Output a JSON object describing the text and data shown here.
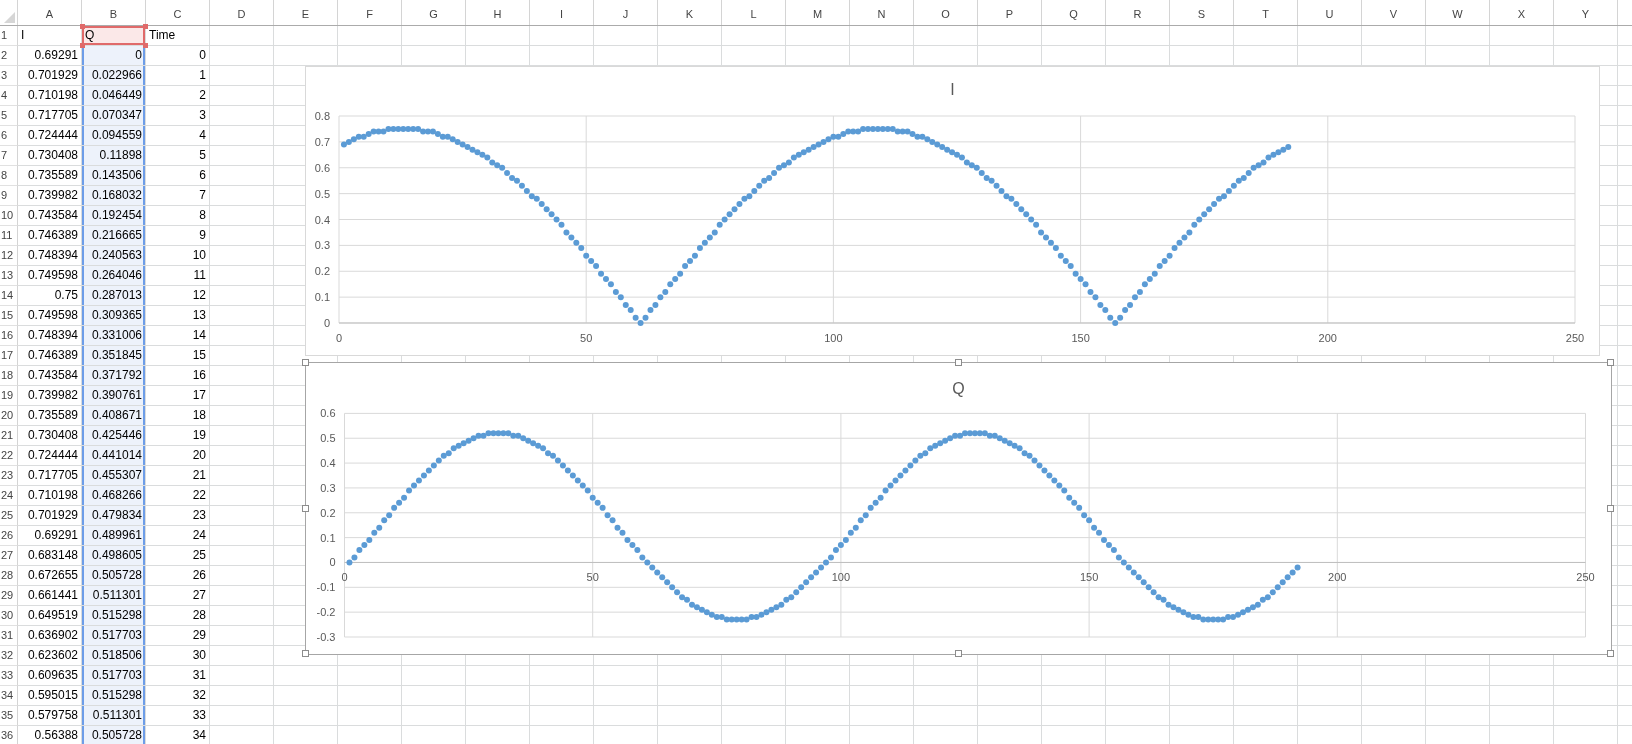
{
  "sheet": {
    "columns": [
      {
        "label": "A",
        "highlighted": false
      },
      {
        "label": "B",
        "highlighted": true
      },
      {
        "label": "C",
        "highlighted": false
      },
      {
        "label": "D",
        "highlighted": false
      },
      {
        "label": "E",
        "highlighted": false
      },
      {
        "label": "F",
        "highlighted": false
      },
      {
        "label": "G",
        "highlighted": false
      },
      {
        "label": "H",
        "highlighted": false
      },
      {
        "label": "I",
        "highlighted": false
      },
      {
        "label": "J",
        "highlighted": false
      },
      {
        "label": "K",
        "highlighted": false
      },
      {
        "label": "L",
        "highlighted": false
      },
      {
        "label": "M",
        "highlighted": false
      },
      {
        "label": "N",
        "highlighted": false
      },
      {
        "label": "O",
        "highlighted": false
      },
      {
        "label": "P",
        "highlighted": false
      },
      {
        "label": "Q",
        "highlighted": false
      },
      {
        "label": "R",
        "highlighted": false
      },
      {
        "label": "S",
        "highlighted": false
      },
      {
        "label": "T",
        "highlighted": false
      },
      {
        "label": "U",
        "highlighted": false
      },
      {
        "label": "V",
        "highlighted": false
      },
      {
        "label": "W",
        "highlighted": false
      },
      {
        "label": "X",
        "highlighted": false
      },
      {
        "label": "Y",
        "highlighted": false
      }
    ],
    "rows": [
      {
        "number": "1",
        "kind": "label",
        "cells": [
          "I",
          "Q",
          "Time"
        ]
      },
      {
        "number": "2",
        "kind": "number",
        "cells": [
          "0.69291",
          "0",
          "0"
        ]
      },
      {
        "number": "3",
        "kind": "number",
        "cells": [
          "0.701929",
          "0.022966",
          "1"
        ]
      },
      {
        "number": "4",
        "kind": "number",
        "cells": [
          "0.710198",
          "0.046449",
          "2"
        ]
      },
      {
        "number": "5",
        "kind": "number",
        "cells": [
          "0.717705",
          "0.070347",
          "3"
        ]
      },
      {
        "number": "6",
        "kind": "number",
        "cells": [
          "0.724444",
          "0.094559",
          "4"
        ]
      },
      {
        "number": "7",
        "kind": "number",
        "cells": [
          "0.730408",
          "0.11898",
          "5"
        ]
      },
      {
        "number": "8",
        "kind": "number",
        "cells": [
          "0.735589",
          "0.143506",
          "6"
        ]
      },
      {
        "number": "9",
        "kind": "number",
        "cells": [
          "0.739982",
          "0.168032",
          "7"
        ]
      },
      {
        "number": "10",
        "kind": "number",
        "cells": [
          "0.743584",
          "0.192454",
          "8"
        ]
      },
      {
        "number": "11",
        "kind": "number",
        "cells": [
          "0.746389",
          "0.216665",
          "9"
        ]
      },
      {
        "number": "12",
        "kind": "number",
        "cells": [
          "0.748394",
          "0.240563",
          "10"
        ]
      },
      {
        "number": "13",
        "kind": "number",
        "cells": [
          "0.749598",
          "0.264046",
          "11"
        ]
      },
      {
        "number": "14",
        "kind": "number",
        "cells": [
          "0.75",
          "0.287013",
          "12"
        ]
      },
      {
        "number": "15",
        "kind": "number",
        "cells": [
          "0.749598",
          "0.309365",
          "13"
        ]
      },
      {
        "number": "16",
        "kind": "number",
        "cells": [
          "0.748394",
          "0.331006",
          "14"
        ]
      },
      {
        "number": "17",
        "kind": "number",
        "cells": [
          "0.746389",
          "0.351845",
          "15"
        ]
      },
      {
        "number": "18",
        "kind": "number",
        "cells": [
          "0.743584",
          "0.371792",
          "16"
        ]
      },
      {
        "number": "19",
        "kind": "number",
        "cells": [
          "0.739982",
          "0.390761",
          "17"
        ]
      },
      {
        "number": "20",
        "kind": "number",
        "cells": [
          "0.735589",
          "0.408671",
          "18"
        ]
      },
      {
        "number": "21",
        "kind": "number",
        "cells": [
          "0.730408",
          "0.425446",
          "19"
        ]
      },
      {
        "number": "22",
        "kind": "number",
        "cells": [
          "0.724444",
          "0.441014",
          "20"
        ]
      },
      {
        "number": "23",
        "kind": "number",
        "cells": [
          "0.717705",
          "0.455307",
          "21"
        ]
      },
      {
        "number": "24",
        "kind": "number",
        "cells": [
          "0.710198",
          "0.468266",
          "22"
        ]
      },
      {
        "number": "25",
        "kind": "number",
        "cells": [
          "0.701929",
          "0.479834",
          "23"
        ]
      },
      {
        "number": "26",
        "kind": "number",
        "cells": [
          "0.69291",
          "0.489961",
          "24"
        ]
      },
      {
        "number": "27",
        "kind": "number",
        "cells": [
          "0.683148",
          "0.498605",
          "25"
        ]
      },
      {
        "number": "28",
        "kind": "number",
        "cells": [
          "0.672655",
          "0.505728",
          "26"
        ]
      },
      {
        "number": "29",
        "kind": "number",
        "cells": [
          "0.661441",
          "0.511301",
          "27"
        ]
      },
      {
        "number": "30",
        "kind": "number",
        "cells": [
          "0.649519",
          "0.515298",
          "28"
        ]
      },
      {
        "number": "31",
        "kind": "number",
        "cells": [
          "0.636902",
          "0.517703",
          "29"
        ]
      },
      {
        "number": "32",
        "kind": "number",
        "cells": [
          "0.623602",
          "0.518506",
          "30"
        ]
      },
      {
        "number": "33",
        "kind": "number",
        "cells": [
          "0.609635",
          "0.517703",
          "31"
        ]
      },
      {
        "number": "34",
        "kind": "number",
        "cells": [
          "0.595015",
          "0.515298",
          "32"
        ]
      },
      {
        "number": "35",
        "kind": "number",
        "cells": [
          "0.579758",
          "0.511301",
          "33"
        ]
      },
      {
        "number": "36",
        "kind": "number",
        "cells": [
          "0.56388",
          "0.505728",
          "34"
        ]
      }
    ]
  },
  "charts": [
    {
      "selected": false,
      "chart_data": {
        "type": "scatter",
        "title": "I",
        "grid": true,
        "x": [
          1,
          2,
          3,
          4,
          5,
          6,
          7,
          8,
          9,
          10,
          11,
          12,
          13,
          14,
          15,
          16,
          17,
          18,
          19,
          20,
          21,
          22,
          23,
          24,
          25,
          26,
          27,
          28,
          29,
          30,
          31,
          32,
          33,
          34,
          35,
          36,
          37,
          38,
          39,
          40,
          41,
          42,
          43,
          44,
          45,
          46,
          47,
          48,
          49,
          50,
          51,
          52,
          53,
          54,
          55,
          56,
          57,
          58,
          59,
          60,
          61,
          62,
          63,
          64,
          65,
          66,
          67,
          68,
          69,
          70,
          71,
          72,
          73,
          74,
          75,
          76,
          77,
          78,
          79,
          80,
          81,
          82,
          83,
          84,
          85,
          86,
          87,
          88,
          89,
          90,
          91,
          92,
          93,
          94,
          95,
          96,
          97,
          98,
          99,
          100,
          101,
          102,
          103,
          104,
          105,
          106,
          107,
          108,
          109,
          110,
          111,
          112,
          113,
          114,
          115,
          116,
          117,
          118,
          119,
          120,
          121,
          122,
          123,
          124,
          125,
          126,
          127,
          128,
          129,
          130,
          131,
          132,
          133,
          134,
          135,
          136,
          137,
          138,
          139,
          140,
          141,
          142,
          143,
          144,
          145,
          146,
          147,
          148,
          149,
          150,
          151,
          152,
          153,
          154,
          155,
          156,
          157,
          158,
          159,
          160,
          161,
          162,
          163,
          164,
          165,
          166,
          167,
          168,
          169,
          170,
          171,
          172,
          173,
          174,
          175,
          176,
          177,
          178,
          179,
          180,
          181,
          182,
          183,
          184,
          185,
          186,
          187,
          188,
          189,
          190,
          191,
          192
        ],
        "series": [
          {
            "color": "#5b9bd5",
            "values": [
              0.69,
              0.7,
              0.71,
              0.72,
              0.72,
              0.73,
              0.74,
              0.74,
              0.74,
              0.75,
              0.75,
              0.75,
              0.75,
              0.75,
              0.75,
              0.75,
              0.74,
              0.74,
              0.74,
              0.73,
              0.72,
              0.72,
              0.71,
              0.7,
              0.69,
              0.68,
              0.67,
              0.66,
              0.65,
              0.64,
              0.62,
              0.61,
              0.6,
              0.58,
              0.56,
              0.55,
              0.53,
              0.51,
              0.49,
              0.48,
              0.46,
              0.44,
              0.42,
              0.4,
              0.38,
              0.35,
              0.33,
              0.31,
              0.29,
              0.26,
              0.24,
              0.22,
              0.19,
              0.17,
              0.15,
              0.12,
              0.1,
              0.07,
              0.05,
              0.02,
              0,
              0.02,
              0.05,
              0.07,
              0.1,
              0.12,
              0.15,
              0.17,
              0.19,
              0.22,
              0.24,
              0.26,
              0.29,
              0.31,
              0.33,
              0.35,
              0.38,
              0.4,
              0.42,
              0.44,
              0.46,
              0.48,
              0.49,
              0.51,
              0.53,
              0.55,
              0.56,
              0.58,
              0.6,
              0.61,
              0.62,
              0.64,
              0.65,
              0.66,
              0.67,
              0.68,
              0.69,
              0.7,
              0.71,
              0.72,
              0.72,
              0.73,
              0.74,
              0.74,
              0.74,
              0.75,
              0.75,
              0.75,
              0.75,
              0.75,
              0.75,
              0.75,
              0.74,
              0.74,
              0.74,
              0.73,
              0.72,
              0.72,
              0.71,
              0.7,
              0.69,
              0.68,
              0.67,
              0.66,
              0.65,
              0.64,
              0.62,
              0.61,
              0.6,
              0.58,
              0.56,
              0.55,
              0.53,
              0.51,
              0.49,
              0.48,
              0.46,
              0.44,
              0.42,
              0.4,
              0.38,
              0.35,
              0.33,
              0.31,
              0.29,
              0.26,
              0.24,
              0.22,
              0.19,
              0.17,
              0.15,
              0.12,
              0.1,
              0.07,
              0.05,
              0.02,
              0,
              0.02,
              0.05,
              0.07,
              0.1,
              0.12,
              0.15,
              0.17,
              0.19,
              0.22,
              0.24,
              0.26,
              0.29,
              0.31,
              0.33,
              0.35,
              0.38,
              0.4,
              0.42,
              0.44,
              0.46,
              0.48,
              0.49,
              0.51,
              0.53,
              0.55,
              0.56,
              0.58,
              0.6,
              0.61,
              0.62,
              0.64,
              0.65,
              0.66,
              0.67,
              0.68
            ]
          }
        ],
        "xlim": [
          0,
          250
        ],
        "ylim": [
          0,
          0.8
        ],
        "xticks": [
          0,
          50,
          100,
          150,
          200,
          250
        ],
        "yticks": [
          0,
          0.1,
          0.2,
          0.3,
          0.4,
          0.5,
          0.6,
          0.7,
          0.8
        ]
      }
    },
    {
      "selected": true,
      "chart_data": {
        "type": "scatter",
        "title": "Q",
        "grid": true,
        "x": [
          1,
          2,
          3,
          4,
          5,
          6,
          7,
          8,
          9,
          10,
          11,
          12,
          13,
          14,
          15,
          16,
          17,
          18,
          19,
          20,
          21,
          22,
          23,
          24,
          25,
          26,
          27,
          28,
          29,
          30,
          31,
          32,
          33,
          34,
          35,
          36,
          37,
          38,
          39,
          40,
          41,
          42,
          43,
          44,
          45,
          46,
          47,
          48,
          49,
          50,
          51,
          52,
          53,
          54,
          55,
          56,
          57,
          58,
          59,
          60,
          61,
          62,
          63,
          64,
          65,
          66,
          67,
          68,
          69,
          70,
          71,
          72,
          73,
          74,
          75,
          76,
          77,
          78,
          79,
          80,
          81,
          82,
          83,
          84,
          85,
          86,
          87,
          88,
          89,
          90,
          91,
          92,
          93,
          94,
          95,
          96,
          97,
          98,
          99,
          100,
          101,
          102,
          103,
          104,
          105,
          106,
          107,
          108,
          109,
          110,
          111,
          112,
          113,
          114,
          115,
          116,
          117,
          118,
          119,
          120,
          121,
          122,
          123,
          124,
          125,
          126,
          127,
          128,
          129,
          130,
          131,
          132,
          133,
          134,
          135,
          136,
          137,
          138,
          139,
          140,
          141,
          142,
          143,
          144,
          145,
          146,
          147,
          148,
          149,
          150,
          151,
          152,
          153,
          154,
          155,
          156,
          157,
          158,
          159,
          160,
          161,
          162,
          163,
          164,
          165,
          166,
          167,
          168,
          169,
          170,
          171,
          172,
          173,
          174,
          175,
          176,
          177,
          178,
          179,
          180,
          181,
          182,
          183,
          184,
          185,
          186,
          187,
          188,
          189,
          190,
          191,
          192
        ],
        "series": [
          {
            "color": "#5b9bd5",
            "values": [
              0,
              0.02,
              0.05,
              0.07,
              0.09,
              0.12,
              0.14,
              0.17,
              0.19,
              0.22,
              0.24,
              0.26,
              0.29,
              0.31,
              0.33,
              0.35,
              0.37,
              0.39,
              0.41,
              0.43,
              0.44,
              0.46,
              0.47,
              0.48,
              0.49,
              0.5,
              0.51,
              0.51,
              0.52,
              0.52,
              0.52,
              0.52,
              0.52,
              0.51,
              0.51,
              0.5,
              0.49,
              0.48,
              0.47,
              0.46,
              0.44,
              0.43,
              0.41,
              0.39,
              0.37,
              0.35,
              0.33,
              0.31,
              0.29,
              0.26,
              0.24,
              0.22,
              0.19,
              0.17,
              0.14,
              0.12,
              0.09,
              0.07,
              0.05,
              0.02,
              0,
              -0.02,
              -0.04,
              -0.06,
              -0.08,
              -0.1,
              -0.12,
              -0.14,
              -0.15,
              -0.17,
              -0.18,
              -0.19,
              -0.2,
              -0.21,
              -0.22,
              -0.22,
              -0.23,
              -0.23,
              -0.23,
              -0.23,
              -0.23,
              -0.22,
              -0.22,
              -0.21,
              -0.2,
              -0.19,
              -0.18,
              -0.17,
              -0.15,
              -0.14,
              -0.12,
              -0.1,
              -0.08,
              -0.06,
              -0.04,
              -0.02,
              0,
              0.02,
              0.05,
              0.07,
              0.09,
              0.12,
              0.14,
              0.17,
              0.19,
              0.22,
              0.24,
              0.26,
              0.29,
              0.31,
              0.33,
              0.35,
              0.37,
              0.39,
              0.41,
              0.43,
              0.44,
              0.46,
              0.47,
              0.48,
              0.49,
              0.5,
              0.51,
              0.51,
              0.52,
              0.52,
              0.52,
              0.52,
              0.52,
              0.51,
              0.51,
              0.5,
              0.49,
              0.48,
              0.47,
              0.46,
              0.44,
              0.43,
              0.41,
              0.39,
              0.37,
              0.35,
              0.33,
              0.31,
              0.29,
              0.26,
              0.24,
              0.22,
              0.19,
              0.17,
              0.14,
              0.12,
              0.09,
              0.07,
              0.05,
              0.02,
              0,
              -0.02,
              -0.04,
              -0.06,
              -0.08,
              -0.1,
              -0.12,
              -0.14,
              -0.15,
              -0.17,
              -0.18,
              -0.19,
              -0.2,
              -0.21,
              -0.22,
              -0.22,
              -0.23,
              -0.23,
              -0.23,
              -0.23,
              -0.23,
              -0.22,
              -0.22,
              -0.21,
              -0.2,
              -0.19,
              -0.18,
              -0.17,
              -0.15,
              -0.14,
              -0.12,
              -0.1,
              -0.08,
              -0.06,
              -0.04,
              -0.02
            ]
          }
        ],
        "xlim": [
          0,
          250
        ],
        "ylim": [
          -0.3,
          0.6
        ],
        "xticks": [
          0,
          50,
          100,
          150,
          200,
          250
        ],
        "yticks": [
          -0.3,
          -0.2,
          -0.1,
          0,
          0.1,
          0.2,
          0.3,
          0.4,
          0.5,
          0.6
        ]
      }
    }
  ]
}
